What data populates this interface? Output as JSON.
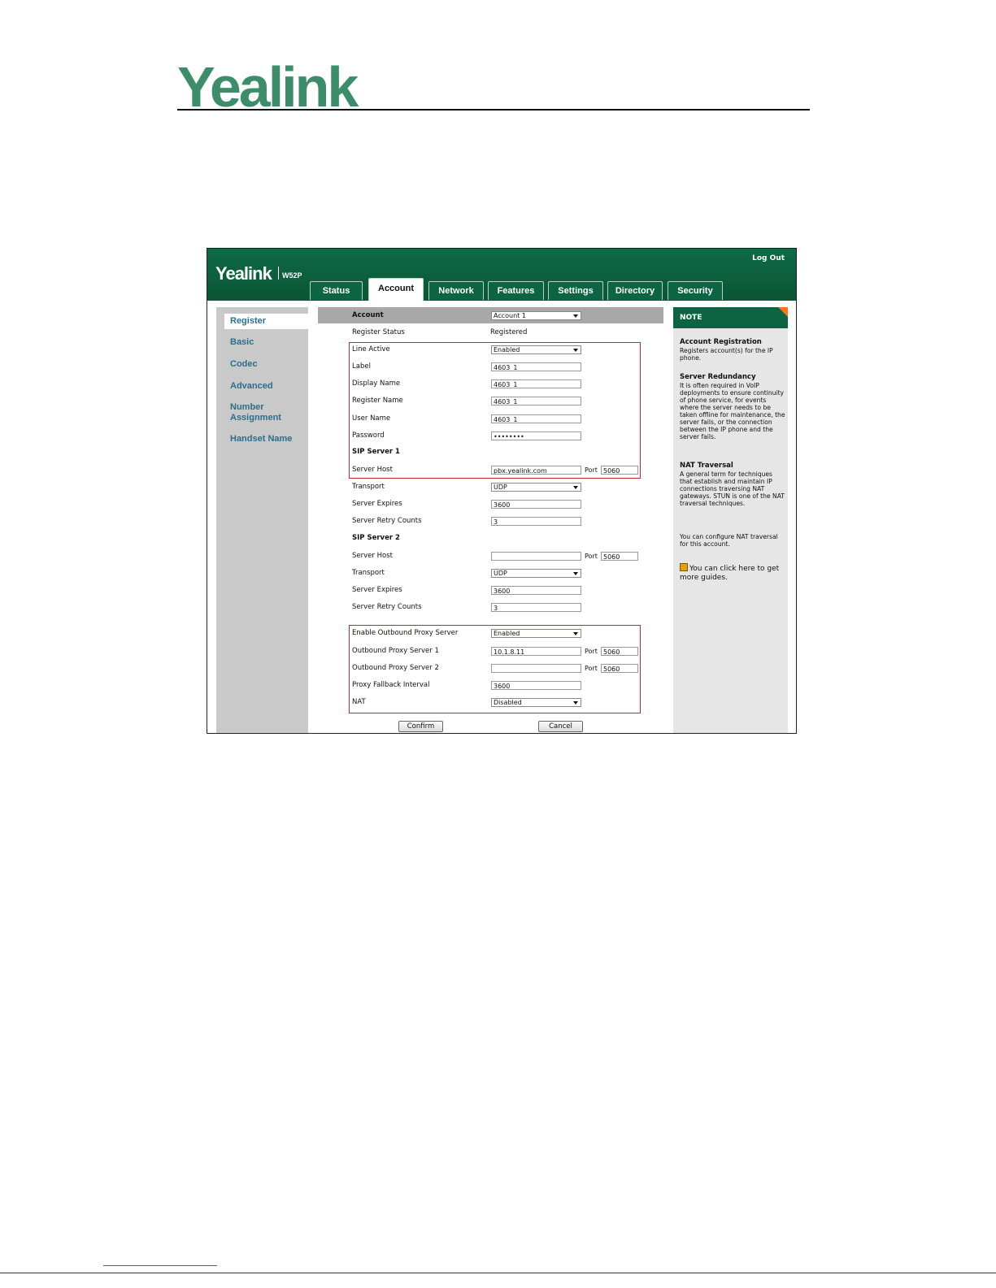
{
  "document": {
    "logo_text": "Yealink"
  },
  "app": {
    "brand": "Yealink",
    "model": "W52P",
    "logout": "Log Out"
  },
  "tabs": [
    "Status",
    "Account",
    "Network",
    "Features",
    "Settings",
    "Directory",
    "Security"
  ],
  "sidebar": [
    "Register",
    "Basic",
    "Codec",
    "Advanced",
    "Number Assignment",
    "Handset Name"
  ],
  "form": {
    "account_label": "Account",
    "account_value": "Account 1",
    "register_status_label": "Register Status",
    "register_status_value": "Registered",
    "line_active_label": "Line Active",
    "line_active_value": "Enabled",
    "label_label": "Label",
    "label_value": "4603_1",
    "display_name_label": "Display Name",
    "display_name_value": "4603_1",
    "register_name_label": "Register Name",
    "register_name_value": "4603_1",
    "user_name_label": "User Name",
    "user_name_value": "4603_1",
    "password_label": "Password",
    "password_value": "••••••••",
    "sip1_heading": "SIP Server 1",
    "sip1_host_label": "Server Host",
    "sip1_host_value": "pbx.yealink.com",
    "port_label": "Port",
    "sip1_port": "5060",
    "sip1_transport_label": "Transport",
    "sip1_transport_value": "UDP",
    "sip1_expires_label": "Server Expires",
    "sip1_expires_value": "3600",
    "sip1_retry_label": "Server Retry Counts",
    "sip1_retry_value": "3",
    "sip2_heading": "SIP Server 2",
    "sip2_host_label": "Server Host",
    "sip2_host_value": "",
    "sip2_port": "5060",
    "sip2_transport_label": "Transport",
    "sip2_transport_value": "UDP",
    "sip2_expires_label": "Server Expires",
    "sip2_expires_value": "3600",
    "sip2_retry_label": "Server Retry Counts",
    "sip2_retry_value": "3",
    "outbound_enable_label": "Enable Outbound Proxy Server",
    "outbound_enable_value": "Enabled",
    "outbound1_label": "Outbound Proxy Server 1",
    "outbound1_value": "10.1.8.11",
    "outbound1_port": "5060",
    "outbound2_label": "Outbound Proxy Server 2",
    "outbound2_value": "",
    "outbound2_port": "5060",
    "fallback_label": "Proxy Fallback Interval",
    "fallback_value": "3600",
    "nat_label": "NAT",
    "nat_value": "Disabled",
    "confirm": "Confirm",
    "cancel": "Cancel"
  },
  "note": {
    "heading": "NOTE",
    "t1": "Account Registration",
    "p1": "Registers account(s) for the IP phone.",
    "t2": "Server Redundancy",
    "p2": "It is often required in VoIP deployments to ensure continuity of phone service, for events where the server needs to be taken offline for maintenance, the server fails, or the connection between the IP phone and the server fails.",
    "t3": "NAT Traversal",
    "p3": "A general term for techniques that establish and maintain IP connections traversing NAT gateways. STUN is one of the NAT traversal techniques.",
    "p4": "You can configure NAT traversal for this account.",
    "guide": "You can click here to get more guides."
  },
  "colors": {
    "header_green": "#0d6442",
    "highlight_red": "#d02232",
    "logo_green": "#3d8c6a"
  }
}
